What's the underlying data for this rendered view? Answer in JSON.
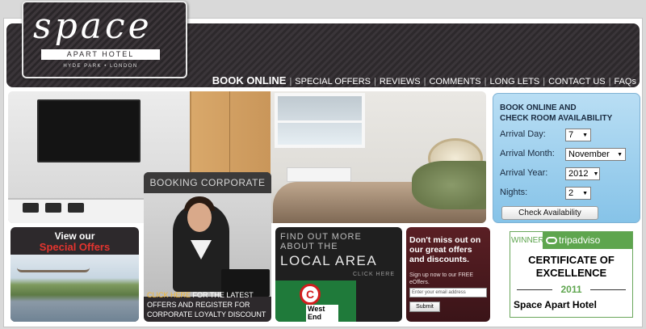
{
  "brand": {
    "logo_word": "space",
    "logo_sub1": "APART HOTEL",
    "logo_sub2": "HYDE PARK • LONDON"
  },
  "nav": {
    "items": [
      "BOOK ONLINE",
      "SPECIAL OFFERS",
      "REVIEWS",
      "COMMENTS",
      "LONG LETS",
      "CONTACT US",
      "FAQs"
    ]
  },
  "booking": {
    "title_line1": "BOOK ONLINE AND",
    "title_line2": "CHECK ROOM AVAILABILITY",
    "arrival_day_label": "Arrival Day:",
    "arrival_day_value": "7",
    "arrival_month_label": "Arrival Month:",
    "arrival_month_value": "November",
    "arrival_year_label": "Arrival Year:",
    "arrival_year_value": "2012",
    "nights_label": "Nights:",
    "nights_value": "2",
    "check_button": "Check Availability"
  },
  "tiles": {
    "offers": {
      "line1": "View our",
      "line2": "Special Offers"
    },
    "corporate": {
      "heading": "BOOKING CORPORATE TRAVEL?",
      "link_text": "CLICK HERE",
      "body_text": " FOR THE LATEST OFFERS AND REGISTER FOR CORPORATE LOYALTY DISCOUNT"
    },
    "local": {
      "line1": "FIND OUT MORE",
      "line2": "ABOUT THE",
      "line3": "LOCAL AREA",
      "click": "CLICK HERE",
      "sign_text": "West End"
    },
    "newsletter": {
      "heading": "Don't miss out on our great offers and discounts.",
      "signup": "Sign up now to our FREE eOffers.",
      "email_placeholder": "Enter your email address",
      "submit": "Submit"
    }
  },
  "tripadvisor": {
    "winner": "WINNER",
    "brand": "tripadviso",
    "cert_line1": "CERTIFICATE OF",
    "cert_line2": "EXCELLENCE",
    "year": "2011",
    "hotel_name": "Space Apart Hotel"
  },
  "colors": {
    "header_dark": "#2d292c",
    "booking_blue": "#86c3e8",
    "offers_red": "#e3342f",
    "trip_green": "#5ea54e",
    "newsletter_maroon": "#5a1f24"
  }
}
